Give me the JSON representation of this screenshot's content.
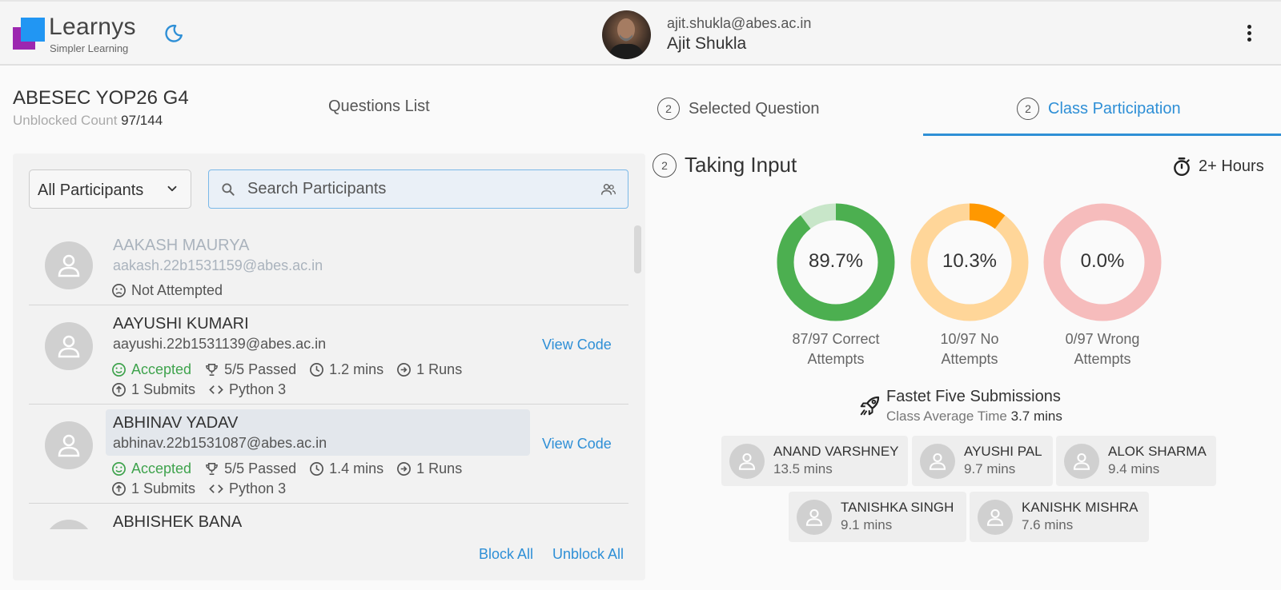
{
  "brand": {
    "name": "Learnys",
    "tagline": "Simpler Learning"
  },
  "user": {
    "email": "ajit.shukla@abes.ac.in",
    "name": "Ajit Shukla"
  },
  "classInfo": {
    "title": "ABESEC YOP26 G4",
    "unblocked_label": "Unblocked Count",
    "unblocked_value": "97/144"
  },
  "tabs": [
    {
      "label": "Questions List",
      "badge": ""
    },
    {
      "label": "Selected Question",
      "badge": "2"
    },
    {
      "label": "Class Participation",
      "badge": "2"
    }
  ],
  "filter": {
    "selected": "All Participants"
  },
  "search": {
    "placeholder": "Search Participants"
  },
  "participants": [
    {
      "name": "AAKASH MAURYA",
      "email": "aakash.22b1531159@abes.ac.in",
      "status": "Not Attempted"
    },
    {
      "name": "AAYUSHI KUMARI",
      "email": "aayushi.22b1531139@abes.ac.in",
      "status": "Accepted",
      "passed": "5/5 Passed",
      "time": "1.2 mins",
      "runs": "1 Runs",
      "submits": "1 Submits",
      "language": "Python 3",
      "action": "View Code"
    },
    {
      "name": "ABHINAV YADAV",
      "email": "abhinav.22b1531087@abes.ac.in",
      "status": "Accepted",
      "passed": "5/5 Passed",
      "time": "1.4 mins",
      "runs": "1 Runs",
      "submits": "1 Submits",
      "language": "Python 3",
      "action": "View Code"
    },
    {
      "name": "ABHISHEK BANA"
    }
  ],
  "listActions": {
    "block_all": "Block All",
    "unblock_all": "Unblock All"
  },
  "stage": {
    "badge": "2",
    "title": "Taking Input",
    "timer": "2+ Hours"
  },
  "stats": [
    {
      "value": "89.7%",
      "fraction": 0.897,
      "caption1": "87/97 Correct",
      "caption2": "Attempts",
      "color": "#4caf50",
      "track": "#c8e6c9"
    },
    {
      "value": "10.3%",
      "fraction": 0.103,
      "caption1": "10/97 No",
      "caption2": "Attempts",
      "color": "#ff9800",
      "track": "#ffd699"
    },
    {
      "value": "0.0%",
      "fraction": 0.0,
      "caption1": "0/97 Wrong",
      "caption2": "Attempts",
      "color": "#f44336",
      "track": "#f6bcbc"
    }
  ],
  "fastest": {
    "title": "Fastet Five Submissions",
    "avg_label": "Class Average Time",
    "avg_value": "3.7 mins",
    "entries": [
      {
        "name": "ANAND VARSHNEY",
        "time": "13.5 mins"
      },
      {
        "name": "AYUSHI PAL",
        "time": "9.7 mins"
      },
      {
        "name": "ALOK SHARMA",
        "time": "9.4 mins"
      },
      {
        "name": "TANISHKA SINGH",
        "time": "9.1 mins"
      },
      {
        "name": "KANISHK MISHRA",
        "time": "7.6 mins"
      }
    ]
  }
}
